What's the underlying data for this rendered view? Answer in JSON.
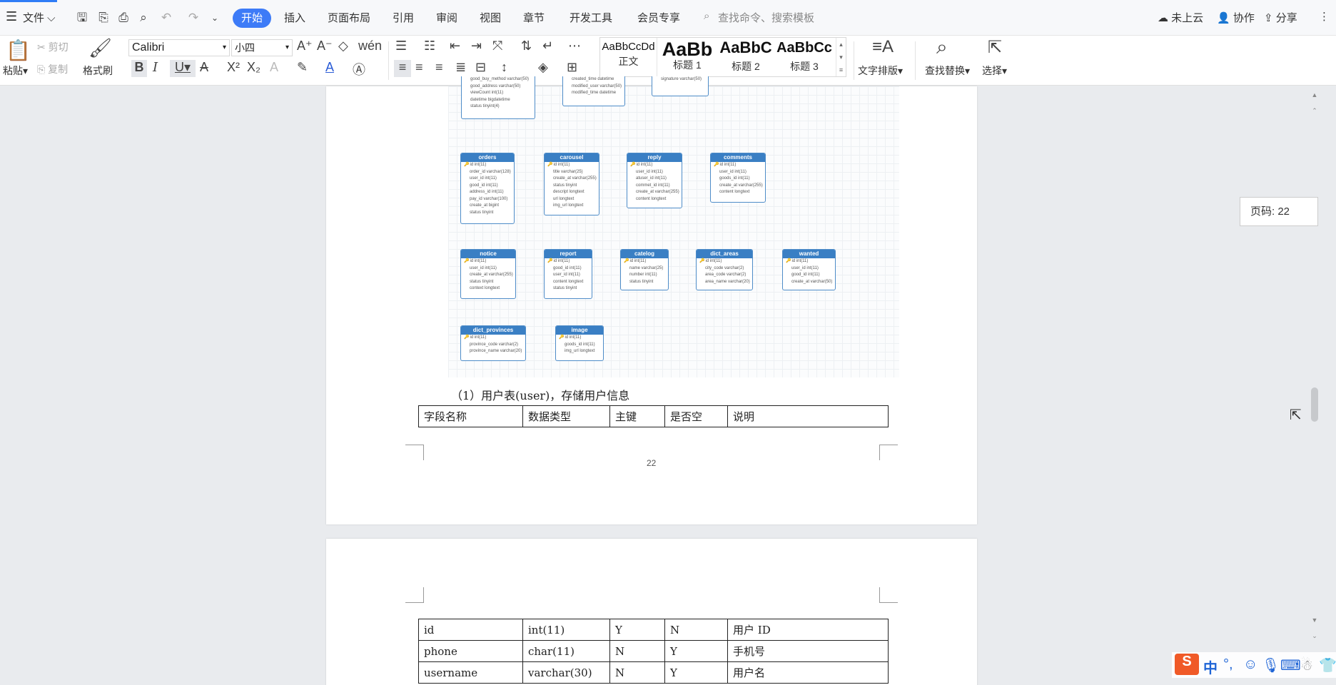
{
  "menu": {
    "file": "文件",
    "tabs": [
      "开始",
      "插入",
      "页面布局",
      "引用",
      "审阅",
      "视图",
      "章节",
      "开发工具",
      "会员专享"
    ],
    "search_placeholder": "查找命令、搜索模板",
    "cloud": "未上云",
    "collab": "协作",
    "share": "分享"
  },
  "ribbon": {
    "paste": "粘贴",
    "cut": "剪切",
    "copy": "复制",
    "format_painter": "格式刷",
    "font_name": "Calibri",
    "font_size": "小四",
    "styles": [
      {
        "preview": "AaBbCcDd",
        "label": "正文"
      },
      {
        "preview": "AaBb",
        "label": "标题 1"
      },
      {
        "preview": "AaBbC",
        "label": "标题 2"
      },
      {
        "preview": "AaBbCc",
        "label": "标题 3"
      }
    ],
    "text_layout": "文字排版",
    "find_replace": "查找替换",
    "select": "选择"
  },
  "er_diagram": {
    "entities": [
      {
        "name": "",
        "fields": [
          "good_buy_method varchar(50)",
          "good_address varchar(50)",
          "viewCount int(11)",
          "datetime bigdatetime",
          "status tinyint(4)"
        ]
      },
      {
        "name": "",
        "fields": [
          "created_time datetime",
          "modified_user varchar(50)",
          "modified_time datetime"
        ]
      },
      {
        "name": "",
        "fields": [
          "signature varchar(50)"
        ]
      },
      {
        "name": "orders",
        "fields": [
          "id int(11)",
          "order_id varchar(128)",
          "user_id int(11)",
          "good_id int(11)",
          "address_id int(11)",
          "pay_id varchar(100)",
          "create_at bigint",
          "status tinyint"
        ]
      },
      {
        "name": "carousel",
        "fields": [
          "id int(11)",
          "title varchar(25)",
          "create_at varchar(255)",
          "status tinyint",
          "descript longtext",
          "url longtext",
          "img_url longtext"
        ]
      },
      {
        "name": "reply",
        "fields": [
          "id int(11)",
          "user_id int(11)",
          "atuser_id int(11)",
          "commet_id int(11)",
          "create_at varchar(255)",
          "content longtext"
        ]
      },
      {
        "name": "comments",
        "fields": [
          "id int(11)",
          "user_id int(11)",
          "goods_id int(11)",
          "create_at varchar(255)",
          "content longtext"
        ]
      },
      {
        "name": "notice",
        "fields": [
          "id int(11)",
          "user_id int(11)",
          "create_at varchar(255)",
          "status tinyint",
          "context longtext"
        ]
      },
      {
        "name": "report",
        "fields": [
          "id int(11)",
          "good_id int(11)",
          "user_id int(11)",
          "content longtext",
          "status tinyint"
        ]
      },
      {
        "name": "catelog",
        "fields": [
          "id int(11)",
          "name varchar(25)",
          "number int(11)",
          "status tinyint"
        ]
      },
      {
        "name": "dict_areas",
        "fields": [
          "id int(11)",
          "city_code varchar(2)",
          "area_code varchar(2)",
          "area_name varchar(20)"
        ]
      },
      {
        "name": "wanted",
        "fields": [
          "id int(11)",
          "user_id int(11)",
          "good_id int(11)",
          "create_at varchar(50)"
        ]
      },
      {
        "name": "dict_provinces",
        "fields": [
          "id int(11)",
          "province_code varchar(2)",
          "province_name varchar(20)"
        ]
      },
      {
        "name": "image",
        "fields": [
          "id int(11)",
          "goods_id int(11)",
          "img_url longtext"
        ]
      }
    ]
  },
  "caption": "（1）用户表(user)，存储用户信息",
  "table_header": [
    "字段名称",
    "数据类型",
    "主键",
    "是否空",
    "说明"
  ],
  "page_number": "22",
  "table_rows": [
    [
      "id",
      "int(11)",
      "Y",
      "N",
      "用户 ID"
    ],
    [
      "phone",
      "char(11)",
      "N",
      "Y",
      "手机号"
    ],
    [
      "username",
      "varchar(30)",
      "N",
      "Y",
      "用户名"
    ]
  ],
  "page_indicator": "页码: 22",
  "ime": {
    "lang": "中"
  }
}
